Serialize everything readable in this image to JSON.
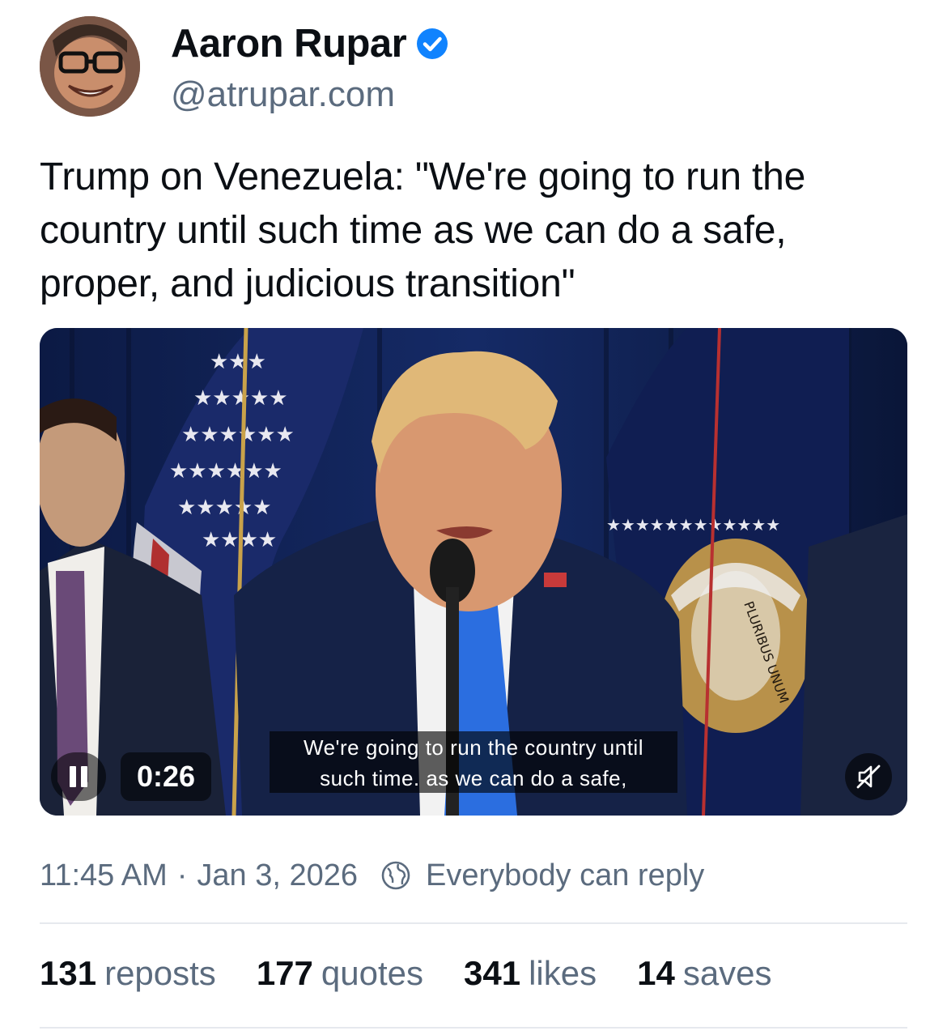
{
  "author": {
    "name": "Aaron Rupar",
    "handle": "@atrupar.com",
    "verified": true
  },
  "post": {
    "text": "Trump on Venezuela: \"We're going to run the country until such time as we can do a safe, proper, and judicious transition\""
  },
  "video": {
    "timestamp": "0:26",
    "caption_line1": "We're going to run the country until",
    "caption_line2": "such time. as we can do a safe,",
    "seal_text": "PLURIBUS UNUM",
    "state": "playing",
    "muted": true
  },
  "meta": {
    "time": "11:45 AM",
    "separator": "·",
    "date": "Jan 3, 2026",
    "reply_setting": "Everybody can reply"
  },
  "stats": [
    {
      "count": "131",
      "label": "reposts"
    },
    {
      "count": "177",
      "label": "quotes"
    },
    {
      "count": "341",
      "label": "likes"
    },
    {
      "count": "14",
      "label": "saves"
    }
  ],
  "colors": {
    "text_primary": "#0b0f14",
    "text_secondary": "#5b6b7e",
    "verified_blue": "#1083fe",
    "divider": "#e6e9ee"
  }
}
